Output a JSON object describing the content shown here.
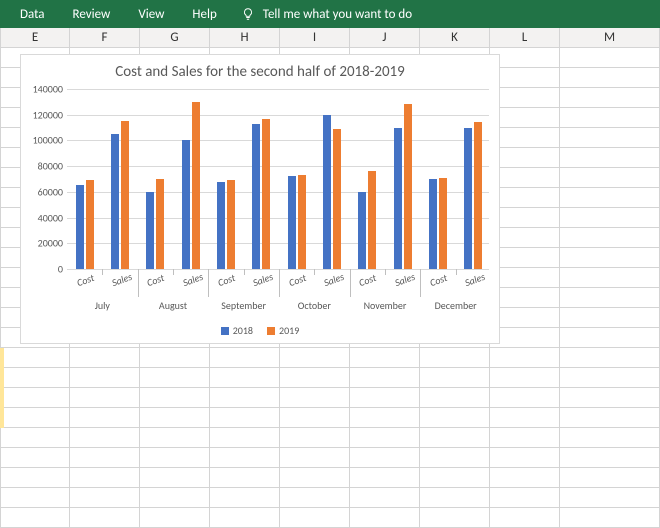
{
  "ribbon": {
    "menu": [
      "Data",
      "Review",
      "View",
      "Help"
    ],
    "tell_me": "Tell me what you want to do"
  },
  "columns": {
    "E": 70,
    "F": 70,
    "G": 70,
    "H": 70,
    "I": 70,
    "J": 70,
    "K": 70,
    "L": 70,
    "M": 100
  },
  "colors": {
    "ribbon_bg": "#217346",
    "s2018": "#4472c4",
    "s2019": "#ed7d31"
  },
  "chart_data": {
    "type": "bar",
    "title": "Cost and Sales for the second half of 2018-2019",
    "ylabel": "",
    "xlabel": "",
    "ylim": [
      0,
      140000
    ],
    "y_ticks": [
      0,
      20000,
      40000,
      60000,
      80000,
      100000,
      120000,
      140000
    ],
    "months": [
      "July",
      "August",
      "September",
      "October",
      "November",
      "December"
    ],
    "subcats": [
      "Cost",
      "Sales"
    ],
    "series": [
      {
        "name": "2018",
        "color": "#4472c4",
        "values": [
          65000,
          105000,
          60000,
          100000,
          68000,
          113000,
          72000,
          120000,
          60000,
          110000,
          70000,
          110000
        ]
      },
      {
        "name": "2019",
        "color": "#ed7d31",
        "values": [
          69000,
          115000,
          70000,
          130000,
          69000,
          117000,
          73000,
          109000,
          76000,
          128000,
          71000,
          114000
        ]
      }
    ],
    "legend_position": "bottom"
  }
}
